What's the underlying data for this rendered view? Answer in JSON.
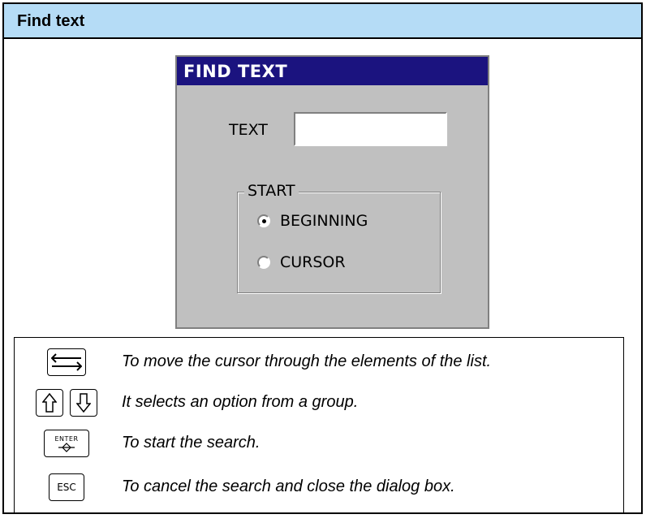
{
  "header": {
    "title": "Find text"
  },
  "dialog": {
    "title": "FIND TEXT",
    "text_label": "TEXT",
    "text_value": "",
    "group_title": "START",
    "options": [
      {
        "label": "BEGINNING",
        "checked": true
      },
      {
        "label": "CURSOR",
        "checked": false
      }
    ]
  },
  "keys": [
    {
      "icon": "tab-key-icon",
      "description": "To move the cursor through the elements of the list."
    },
    {
      "icon": "up-down-arrow-keys-icon",
      "description": "It selects an option from a group."
    },
    {
      "icon": "enter-key-icon",
      "label": "ENTER",
      "description": "To start the search."
    },
    {
      "icon": "esc-key-icon",
      "label": "ESC",
      "description": "To cancel the search and close the dialog box."
    }
  ]
}
